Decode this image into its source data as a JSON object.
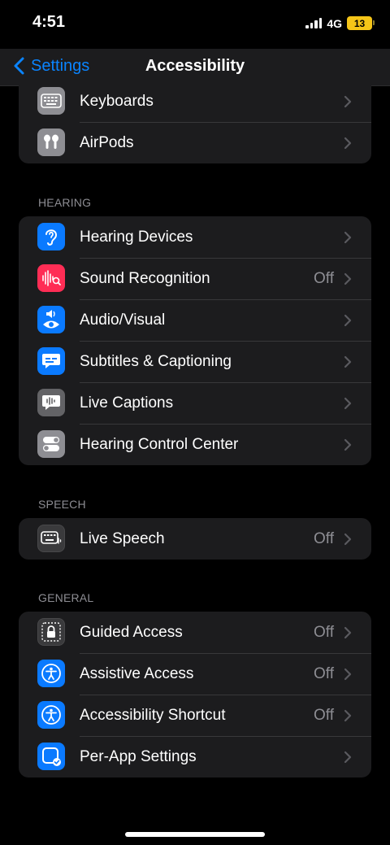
{
  "status": {
    "time": "4:51",
    "network": "4G",
    "battery": "13"
  },
  "nav": {
    "back_label": "Settings",
    "title": "Accessibility"
  },
  "top_group": [
    {
      "label": "Keyboards",
      "value": "",
      "icon": "keyboard-icon"
    },
    {
      "label": "AirPods",
      "value": "",
      "icon": "airpods-icon"
    }
  ],
  "hearing": {
    "header": "HEARING",
    "items": [
      {
        "label": "Hearing Devices",
        "value": "",
        "icon": "ear-icon"
      },
      {
        "label": "Sound Recognition",
        "value": "Off",
        "icon": "waveform-search-icon"
      },
      {
        "label": "Audio/Visual",
        "value": "",
        "icon": "speaker-eye-icon"
      },
      {
        "label": "Subtitles & Captioning",
        "value": "",
        "icon": "captions-bubble-icon"
      },
      {
        "label": "Live Captions",
        "value": "",
        "icon": "live-captions-icon"
      },
      {
        "label": "Hearing Control Center",
        "value": "",
        "icon": "toggles-icon"
      }
    ]
  },
  "speech": {
    "header": "SPEECH",
    "items": [
      {
        "label": "Live Speech",
        "value": "Off",
        "icon": "keyboard-speech-icon"
      }
    ]
  },
  "general": {
    "header": "GENERAL",
    "items": [
      {
        "label": "Guided Access",
        "value": "Off",
        "icon": "lock-icon"
      },
      {
        "label": "Assistive Access",
        "value": "Off",
        "icon": "accessibility-person-icon"
      },
      {
        "label": "Accessibility Shortcut",
        "value": "Off",
        "icon": "accessibility-person-icon"
      },
      {
        "label": "Per-App Settings",
        "value": "",
        "icon": "app-check-icon"
      }
    ]
  }
}
